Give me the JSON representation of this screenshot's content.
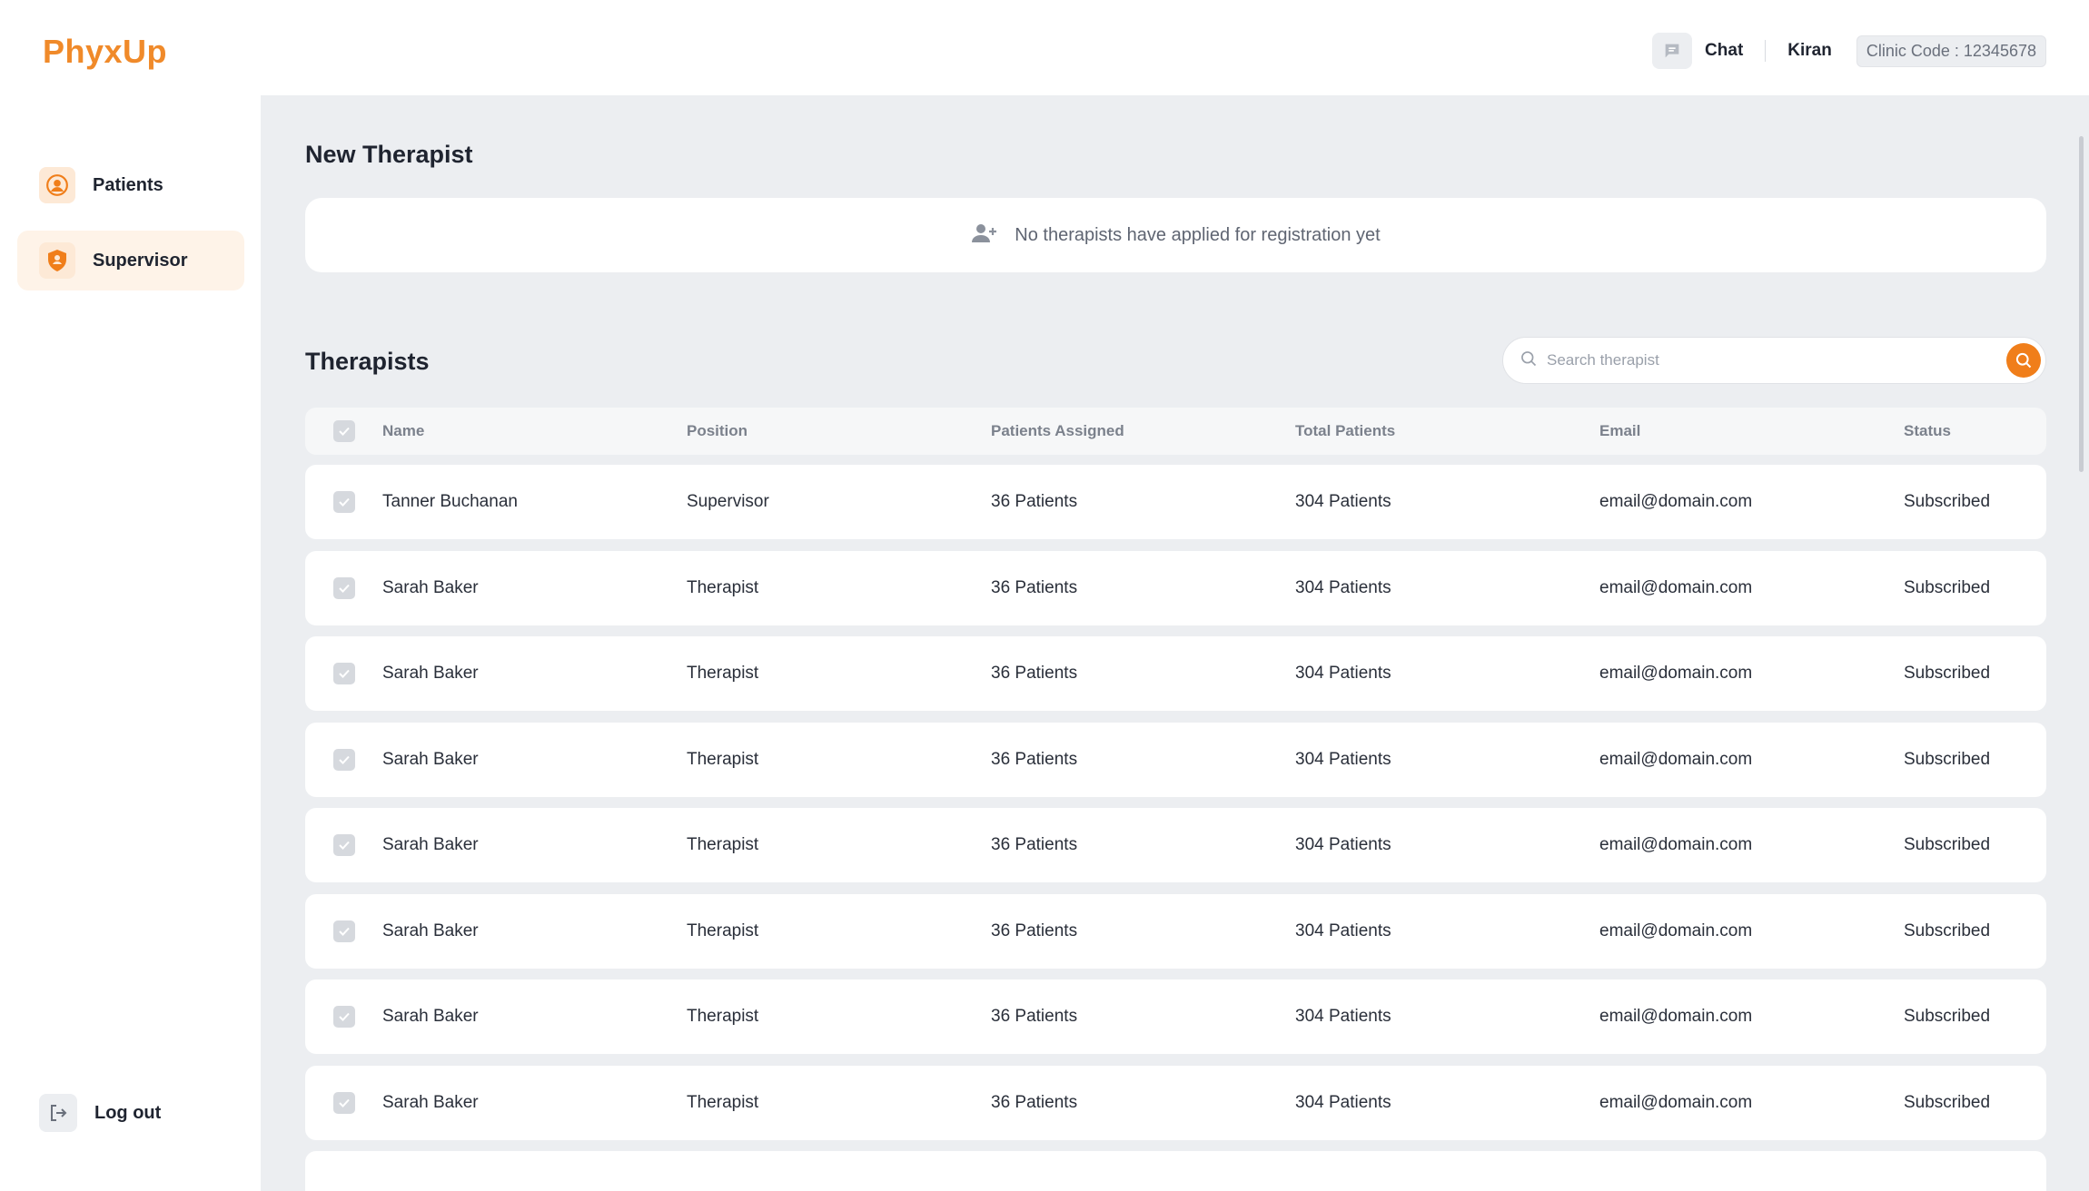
{
  "header": {
    "logo": "PhyxUp",
    "chat_label": "Chat",
    "user_name": "Kiran",
    "clinic_code": "Clinic Code : 12345678"
  },
  "sidebar": {
    "items": [
      {
        "label": "Patients",
        "icon": "user-circle-icon",
        "active": false
      },
      {
        "label": "Supervisor",
        "icon": "shield-icon",
        "active": true
      }
    ],
    "logout_label": "Log out"
  },
  "new_therapist": {
    "title": "New Therapist",
    "empty_message": "No therapists have applied for registration yet"
  },
  "therapists": {
    "title": "Therapists",
    "search_placeholder": "Search therapist",
    "columns": [
      "Name",
      "Position",
      "Patients Assigned",
      "Total Patients",
      "Email",
      "Status"
    ],
    "rows": [
      {
        "name": "Tanner Buchanan",
        "position": "Supervisor",
        "assigned": "36 Patients",
        "total": "304 Patients",
        "email": "email@domain.com",
        "status": "Subscribed"
      },
      {
        "name": "Sarah Baker",
        "position": "Therapist",
        "assigned": "36 Patients",
        "total": "304 Patients",
        "email": "email@domain.com",
        "status": "Subscribed"
      },
      {
        "name": "Sarah Baker",
        "position": "Therapist",
        "assigned": "36 Patients",
        "total": "304 Patients",
        "email": "email@domain.com",
        "status": "Subscribed"
      },
      {
        "name": "Sarah Baker",
        "position": "Therapist",
        "assigned": "36 Patients",
        "total": "304 Patients",
        "email": "email@domain.com",
        "status": "Subscribed"
      },
      {
        "name": "Sarah Baker",
        "position": "Therapist",
        "assigned": "36 Patients",
        "total": "304 Patients",
        "email": "email@domain.com",
        "status": "Subscribed"
      },
      {
        "name": "Sarah Baker",
        "position": "Therapist",
        "assigned": "36 Patients",
        "total": "304 Patients",
        "email": "email@domain.com",
        "status": "Subscribed"
      },
      {
        "name": "Sarah Baker",
        "position": "Therapist",
        "assigned": "36 Patients",
        "total": "304 Patients",
        "email": "email@domain.com",
        "status": "Subscribed"
      },
      {
        "name": "Sarah Baker",
        "position": "Therapist",
        "assigned": "36 Patients",
        "total": "304 Patients",
        "email": "email@domain.com",
        "status": "Subscribed"
      }
    ]
  },
  "colors": {
    "accent": "#f07e1a",
    "background": "#eceef1",
    "active_nav": "#fef3e8"
  }
}
